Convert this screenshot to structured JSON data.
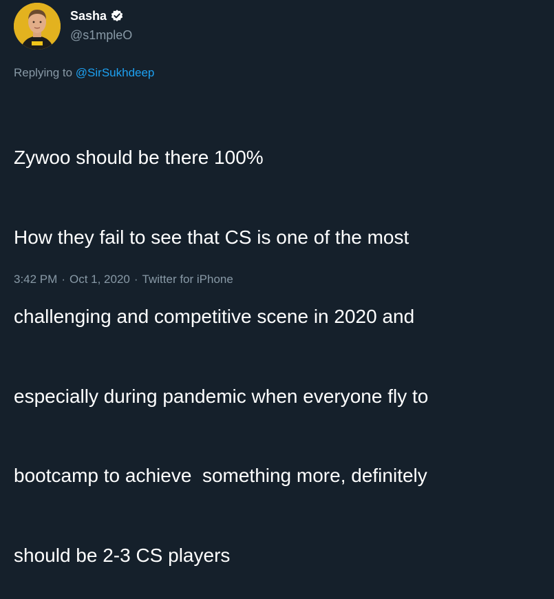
{
  "author": {
    "display_name": "Sasha",
    "handle": "@s1mpleO",
    "verified_icon": "verified-badge-icon"
  },
  "reply": {
    "prefix": "Replying to ",
    "mention": "@SirSukhdeep"
  },
  "tweet": {
    "lines": [
      "Zywoo should be there 100%",
      "How they fail to see that CS is one of the most",
      "challenging and competitive scene in 2020 and",
      "especially during pandemic when everyone fly to",
      "bootcamp to achieve  something more, definitely",
      "should be 2-3 CS players"
    ]
  },
  "meta": {
    "time": "3:42 PM",
    "separator": "·",
    "date": "Oct 1, 2020",
    "source": "Twitter for iPhone"
  },
  "colors": {
    "background": "#15202b",
    "text": "#ffffff",
    "muted": "#8899a6",
    "accent": "#1da1f2"
  }
}
